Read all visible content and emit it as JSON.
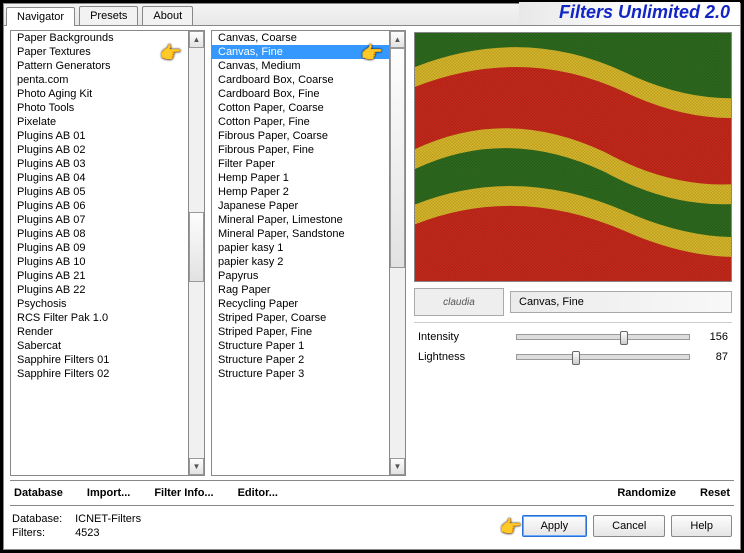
{
  "title": "Filters Unlimited 2.0",
  "tabs": [
    "Navigator",
    "Presets",
    "About"
  ],
  "categories": [
    "Paper Backgrounds",
    "Paper Textures",
    "Pattern Generators",
    "penta.com",
    "Photo Aging Kit",
    "Photo Tools",
    "Pixelate",
    "Plugins AB 01",
    "Plugins AB 02",
    "Plugins AB 03",
    "Plugins AB 04",
    "Plugins AB 05",
    "Plugins AB 06",
    "Plugins AB 07",
    "Plugins AB 08",
    "Plugins AB 09",
    "Plugins AB 10",
    "Plugins AB 21",
    "Plugins AB 22",
    "Psychosis",
    "RCS Filter Pak 1.0",
    "Render",
    "Sabercat",
    "Sapphire Filters 01",
    "Sapphire Filters 02"
  ],
  "selected_category_index": 1,
  "filters": [
    "Canvas, Coarse",
    "Canvas, Fine",
    "Canvas, Medium",
    "Cardboard Box, Coarse",
    "Cardboard Box, Fine",
    "Cotton Paper, Coarse",
    "Cotton Paper, Fine",
    "Fibrous Paper, Coarse",
    "Fibrous Paper, Fine",
    "Filter Paper",
    "Hemp Paper 1",
    "Hemp Paper 2",
    "Japanese Paper",
    "Mineral Paper, Limestone",
    "Mineral Paper, Sandstone",
    "papier kasy 1",
    "papier kasy 2",
    "Papyrus",
    "Rag Paper",
    "Recycling Paper",
    "Striped Paper, Coarse",
    "Striped Paper, Fine",
    "Structure Paper 1",
    "Structure Paper 2",
    "Structure Paper 3"
  ],
  "selected_filter_index": 1,
  "current_filter": "Canvas, Fine",
  "logo_text": "claudia",
  "params": [
    {
      "label": "Intensity",
      "value": 156,
      "pos": 60
    },
    {
      "label": "Lightness",
      "value": 87,
      "pos": 32
    }
  ],
  "toolbar": {
    "database": "Database",
    "import": "Import...",
    "filter_info": "Filter Info...",
    "editor": "Editor...",
    "randomize": "Randomize",
    "reset": "Reset"
  },
  "meta": {
    "db_label": "Database:",
    "db_value": "ICNET-Filters",
    "filters_label": "Filters:",
    "filters_value": "4523"
  },
  "buttons": {
    "apply": "Apply",
    "cancel": "Cancel",
    "help": "Help"
  }
}
